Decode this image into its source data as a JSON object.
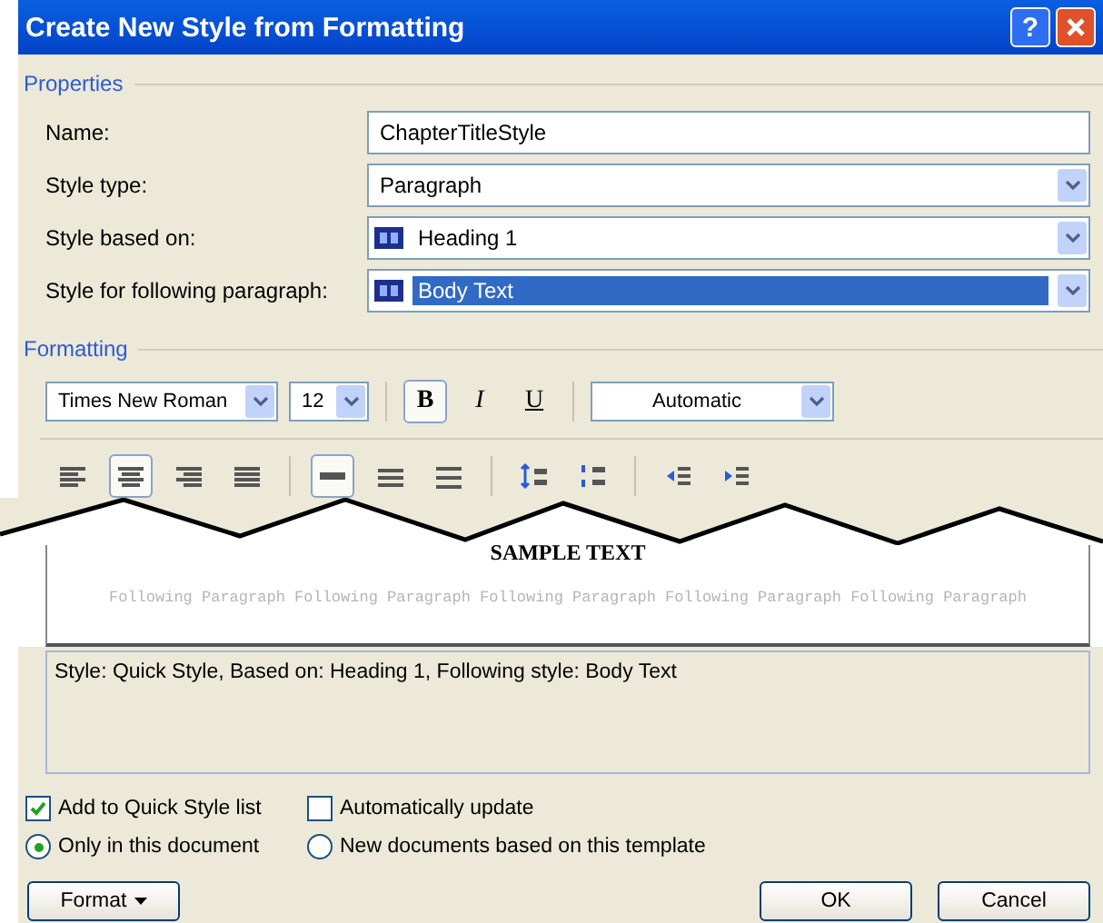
{
  "window": {
    "title": "Create New Style from Formatting",
    "help": "?"
  },
  "properties": {
    "heading": "Properties",
    "rows": [
      {
        "kind": "text",
        "label": "Name:",
        "value": "ChapterTitleStyle",
        "highlighted": false
      },
      {
        "kind": "dropdown",
        "label": "Style type:",
        "value": "Paragraph",
        "highlighted": false
      },
      {
        "kind": "style-dropdown",
        "label": "Style based on:",
        "value": "Heading 1",
        "highlighted": false
      },
      {
        "kind": "style-dropdown",
        "label": "Style for following paragraph:",
        "value": "Body Text",
        "highlighted": true
      }
    ]
  },
  "formatting": {
    "heading": "Formatting",
    "font": "Times New Roman",
    "size": "12",
    "styles": [
      {
        "kind": "bold",
        "label": "B",
        "selected": true
      },
      {
        "kind": "italic",
        "label": "I",
        "selected": false
      },
      {
        "kind": "underline",
        "label": "U",
        "selected": false
      }
    ],
    "font_color_choice": "Automatic",
    "paragraph_tools": [
      [
        {
          "kind": "align-left",
          "selected": false
        },
        {
          "kind": "align-center",
          "selected": true
        },
        {
          "kind": "align-right",
          "selected": false
        },
        {
          "kind": "justify",
          "selected": false
        }
      ],
      [
        {
          "kind": "single-spacing",
          "selected": true
        },
        {
          "kind": "one-half-spacing",
          "selected": false
        },
        {
          "kind": "double-spacing",
          "selected": false
        }
      ],
      [
        {
          "kind": "space-before",
          "selected": false
        },
        {
          "kind": "space-after",
          "selected": false
        }
      ],
      [
        {
          "kind": "indent-decrease",
          "selected": false
        },
        {
          "kind": "indent-increase",
          "selected": false
        }
      ]
    ]
  },
  "preview": {
    "sample": "SAMPLE TEXT",
    "following": "Following Paragraph Following Paragraph Following Paragraph Following Paragraph Following Paragraph"
  },
  "description": "Style: Quick Style, Based on: Heading 1, Following style: Body Text",
  "checkboxes": [
    {
      "label": "Add to Quick Style list",
      "checked": true
    },
    {
      "label": "Automatically update",
      "checked": false
    }
  ],
  "radios": [
    {
      "label": "Only in this document",
      "selected": true
    },
    {
      "label": "New documents based on this template",
      "selected": false
    }
  ],
  "buttons": {
    "format": "Format",
    "ok": "OK",
    "cancel": "Cancel"
  }
}
